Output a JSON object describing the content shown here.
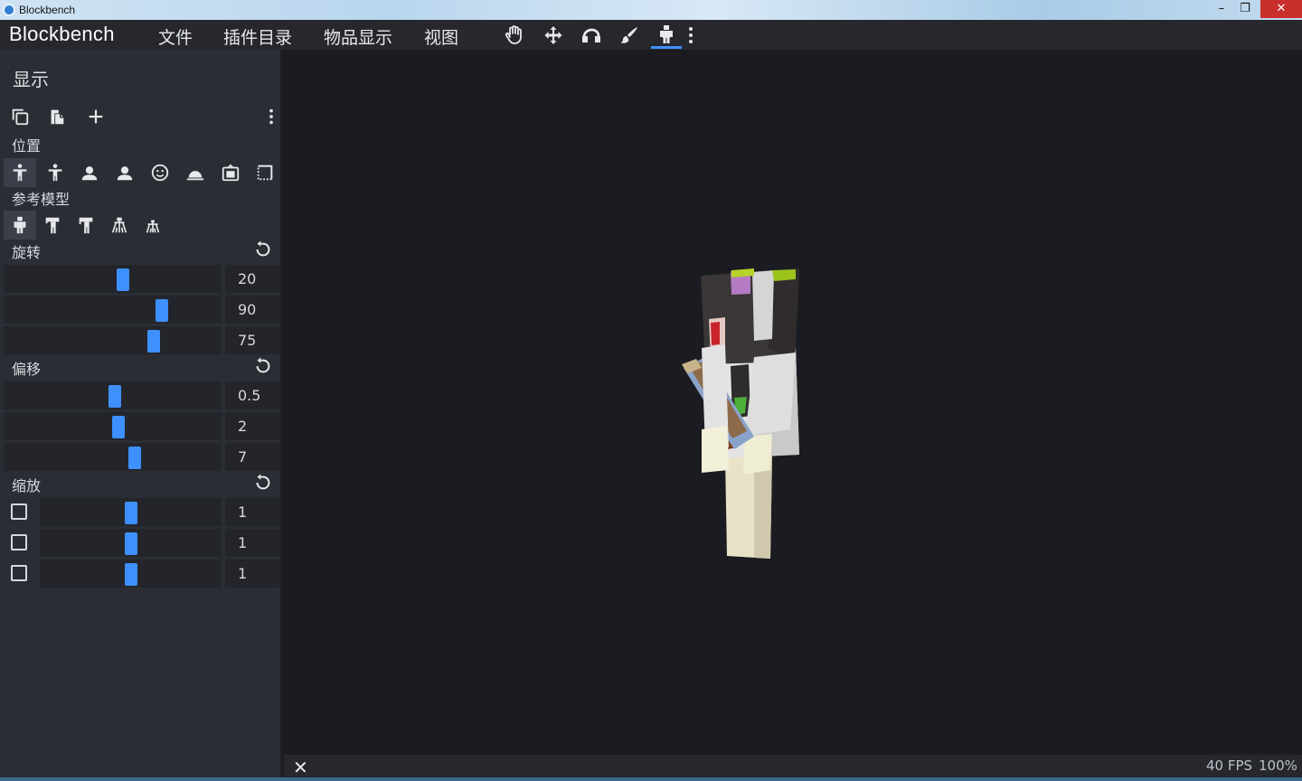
{
  "window": {
    "title": "Blockbench",
    "controls": [
      "minimize",
      "restore",
      "close"
    ]
  },
  "menu": {
    "brand": "Blockbench",
    "items": [
      "文件",
      "插件目录",
      "物品显示",
      "视图"
    ],
    "tools": [
      {
        "icon": "hand-pan-icon"
      },
      {
        "icon": "move-arrows-icon"
      },
      {
        "icon": "rotate-icon"
      },
      {
        "icon": "paint-brush-icon"
      },
      {
        "icon": "player-figure-icon",
        "active": true
      },
      {
        "icon": "more-vertical-icon"
      }
    ]
  },
  "sidebar": {
    "title": "显示",
    "actions": [
      {
        "icon": "copy-icon"
      },
      {
        "icon": "paste-icon"
      },
      {
        "icon": "add-icon"
      },
      {
        "icon": "more-vertical-icon"
      }
    ],
    "position_label": "位置",
    "position_slots": [
      {
        "icon": "thirdperson-right-icon",
        "active": true
      },
      {
        "icon": "thirdperson-left-icon"
      },
      {
        "icon": "firstperson-right-icon"
      },
      {
        "icon": "firstperson-left-icon"
      },
      {
        "icon": "head-icon"
      },
      {
        "icon": "ground-icon"
      },
      {
        "icon": "item-frame-icon"
      },
      {
        "icon": "gui-icon"
      }
    ],
    "reference_label": "参考模型",
    "reference_models": [
      {
        "icon": "player-model-icon",
        "active": true
      },
      {
        "icon": "zombie-model-icon"
      },
      {
        "icon": "armor-stand-icon"
      },
      {
        "icon": "baby-zombie-icon"
      },
      {
        "icon": "small-armor-stand-icon"
      }
    ],
    "rotation": {
      "label": "旋转",
      "values": [
        "20",
        "90",
        "75"
      ],
      "slider_fraction": [
        0.55,
        0.74,
        0.7
      ]
    },
    "translation": {
      "label": "偏移",
      "values": [
        "0.5",
        "2",
        "7"
      ],
      "slider_fraction": [
        0.51,
        0.53,
        0.61
      ]
    },
    "scale": {
      "label": "缩放",
      "values": [
        "1",
        "1",
        "1"
      ],
      "slider_fraction": [
        0.5,
        0.5,
        0.5
      ],
      "checkbox_checked": [
        false,
        false,
        false
      ]
    }
  },
  "status": {
    "fps": "40 FPS",
    "zoom": "100%"
  },
  "colors": {
    "accent": "#3e90ff",
    "panel": "#2b2d34",
    "viewport": "#1b1c21",
    "menubar": "#26282e"
  }
}
